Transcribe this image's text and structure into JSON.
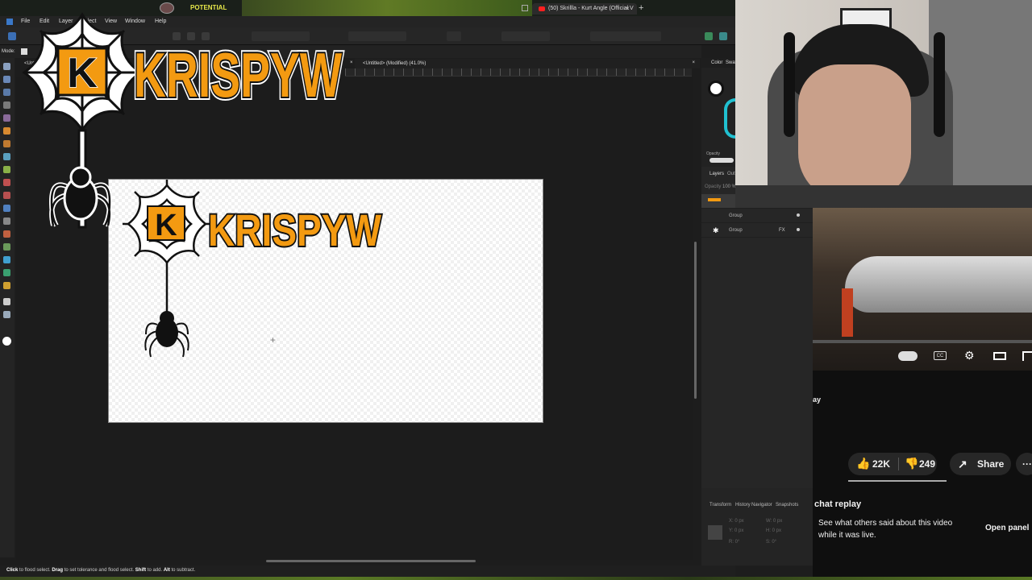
{
  "browser": {
    "tab_title": "(50) Skrillla - Kurt Angle (Official V",
    "close_glyph": "×",
    "new_tab_glyph": "+"
  },
  "stream_banner": {
    "text": "POTENTIAL"
  },
  "menu": {
    "items": [
      "File",
      "Edit",
      "Layer",
      "Select",
      "View",
      "Window",
      "Help"
    ]
  },
  "context": {
    "mode_label": "Mode:",
    "untitled_tab": "<Untitled>"
  },
  "document": {
    "tab_label": "<Untitled> (Modified) (41.0%)",
    "close_glyph": "×"
  },
  "logo": {
    "wordmark": "KRISPYW",
    "letter": "K"
  },
  "panels": {
    "color_tab": "Color",
    "swatches_tab": "Swatc",
    "opacity_label": "Opacity",
    "layers_tab": "Layers",
    "outline_tab": "Outli",
    "opacity_row": "Opacity",
    "opacity_value": "100 %",
    "layers": [
      {
        "name": "Group",
        "fx": ""
      },
      {
        "name": "Group",
        "fx": "FX"
      }
    ],
    "bottom_tabs": [
      "Transform",
      "History",
      "Navigator",
      "Snapshots"
    ],
    "transform_fields": [
      "X: 0 px",
      "Y: 0 px",
      "W: 0 px",
      "H: 0 px",
      "R: 0°",
      "S: 0°"
    ]
  },
  "status": {
    "text_1": "Click",
    "text_2": " to flood select. ",
    "text_3": "Drag",
    "text_4": " to set tolerance and flood select. ",
    "text_5": "Shift",
    "text_6": " to add. ",
    "text_7": "Alt",
    "text_8": " to subtract."
  },
  "youtube": {
    "title_fragment": "ay",
    "like_count": "22K",
    "dislike_count": "249",
    "share_label": "Share",
    "more_glyph": "···",
    "chat_title": "chat replay",
    "chat_description": "See what others said about this video while it was live.",
    "open_panel_label": "Open panel",
    "cc_label": "CC"
  },
  "colors": {
    "accent_orange": "#f39a11",
    "yt_red": "#ff0000",
    "yt_bg": "#0f0f0f"
  }
}
